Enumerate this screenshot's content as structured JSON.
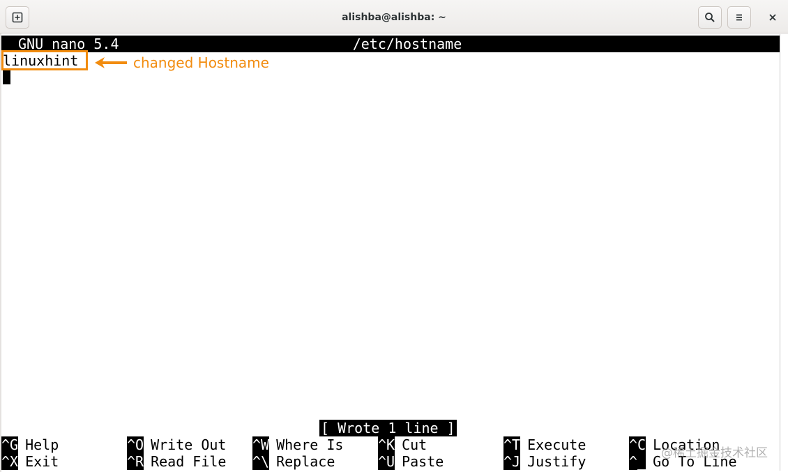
{
  "window": {
    "title": "alishba@alishba: ~",
    "buttons": {
      "new_tab_icon": "new-tab-icon",
      "search_icon": "search-icon",
      "menu_icon": "hamburger-menu-icon",
      "close_glyph": "×"
    }
  },
  "nano": {
    "version": "GNU nano 5.4",
    "filename": "/etc/hostname",
    "content": "linuxhint",
    "status": "[ Wrote 1 line ]",
    "shortcuts_row1": [
      {
        "key": "^G",
        "label": "Help"
      },
      {
        "key": "^O",
        "label": "Write Out"
      },
      {
        "key": "^W",
        "label": "Where Is"
      },
      {
        "key": "^K",
        "label": "Cut"
      },
      {
        "key": "^T",
        "label": "Execute"
      },
      {
        "key": "^C",
        "label": "Location"
      }
    ],
    "shortcuts_row2": [
      {
        "key": "^X",
        "label": "Exit"
      },
      {
        "key": "^R",
        "label": "Read File"
      },
      {
        "key": "^\\",
        "label": "Replace"
      },
      {
        "key": "^U",
        "label": "Paste"
      },
      {
        "key": "^J",
        "label": "Justify"
      },
      {
        "key": "^_",
        "label": "Go To Line"
      }
    ]
  },
  "annotation": {
    "text": "changed Hostname",
    "color": "#f28c0f"
  },
  "watermark": "@稀土掘金技术社区"
}
